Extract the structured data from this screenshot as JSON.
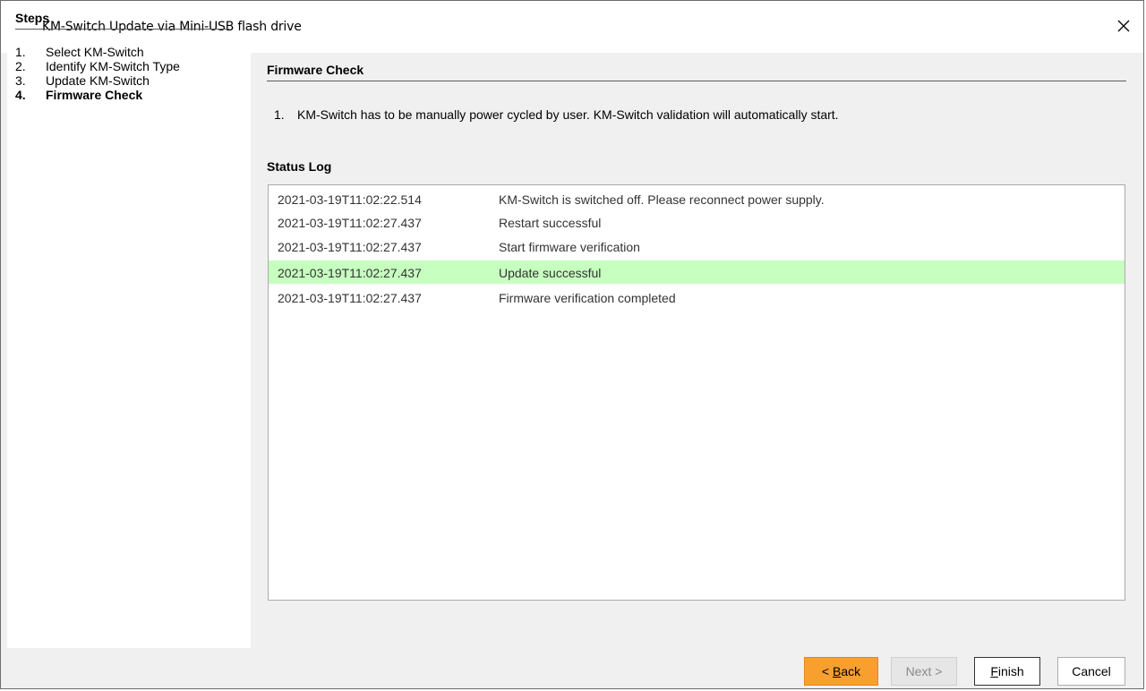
{
  "window": {
    "title": "KM-Switch Update via Mini-USB flash drive"
  },
  "steps": {
    "heading": "Steps",
    "items": [
      {
        "num": "1.",
        "label": "Select KM-Switch"
      },
      {
        "num": "2.",
        "label": "Identify KM-Switch Type"
      },
      {
        "num": "3.",
        "label": "Update KM-Switch"
      },
      {
        "num": "4.",
        "label": "Firmware Check"
      }
    ]
  },
  "content": {
    "heading": "Firmware Check",
    "instruction_num": "1.",
    "instruction": "KM-Switch has to be manually power cycled by user. KM-Switch validation will automatically start.",
    "status_log_heading": "Status Log",
    "log": [
      {
        "time": "2021-03-19T11:02:22.514",
        "message": "KM-Switch is switched off. Please reconnect power supply."
      },
      {
        "time": "2021-03-19T11:02:27.437",
        "message": "Restart successful"
      },
      {
        "time": "2021-03-19T11:02:27.437",
        "message": "Start firmware verification"
      },
      {
        "time": "2021-03-19T11:02:27.437",
        "message": "Update successful"
      },
      {
        "time": "2021-03-19T11:02:27.437",
        "message": "Firmware verification completed"
      }
    ]
  },
  "buttons": {
    "back_prefix": "< ",
    "back_mnemonic": "B",
    "back_rest": "ack",
    "next": "Next >",
    "finish_mnemonic": "F",
    "finish_rest": "inish",
    "cancel": "Cancel"
  },
  "colors": {
    "highlight_row": "#c7ffc0",
    "back_button": "#f7a030"
  }
}
